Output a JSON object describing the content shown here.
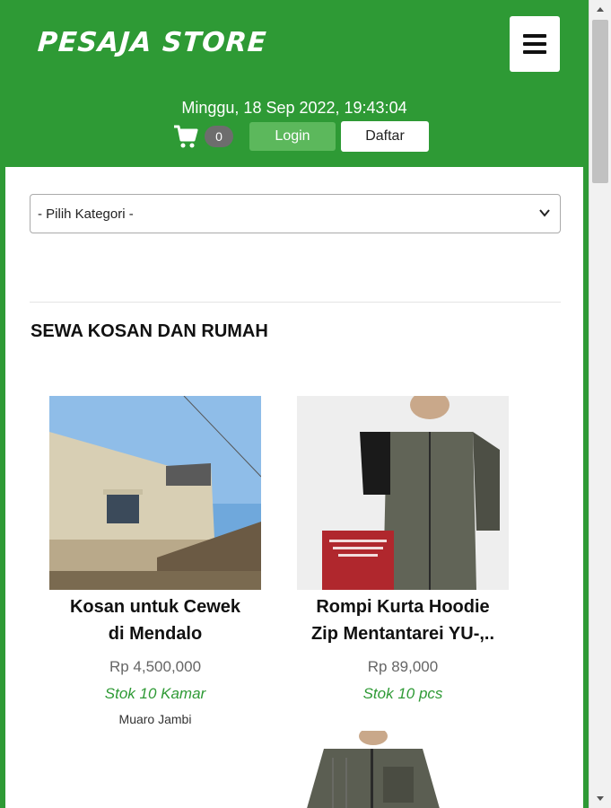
{
  "header": {
    "logo": "PESAJA STORE",
    "datetime": "Minggu, 18 Sep 2022, 19:43:04",
    "cart_count": "0",
    "login_label": "Login",
    "register_label": "Daftar",
    "menu_icon": "hamburger-icon",
    "cart_icon": "shopping-cart-icon"
  },
  "filter": {
    "category_selected": "- Pilih Kategori -"
  },
  "section": {
    "title": "SEWA KOSAN DAN RUMAH"
  },
  "products": [
    {
      "name_line1": "Kosan untuk Cewek",
      "name_line2": "di Mendalo",
      "price": "Rp 4,500,000",
      "stock": "Stok 10 Kamar",
      "location": "Muaro Jambi"
    },
    {
      "name_line1": "Rompi Kurta Hoodie",
      "name_line2": "Zip Mentantarei YU-,..",
      "price": "Rp 89,000",
      "stock": "Stok 10 pcs",
      "location": ""
    }
  ],
  "colors": {
    "brand_green": "#2e9a35",
    "login_green": "#5cb85c"
  }
}
